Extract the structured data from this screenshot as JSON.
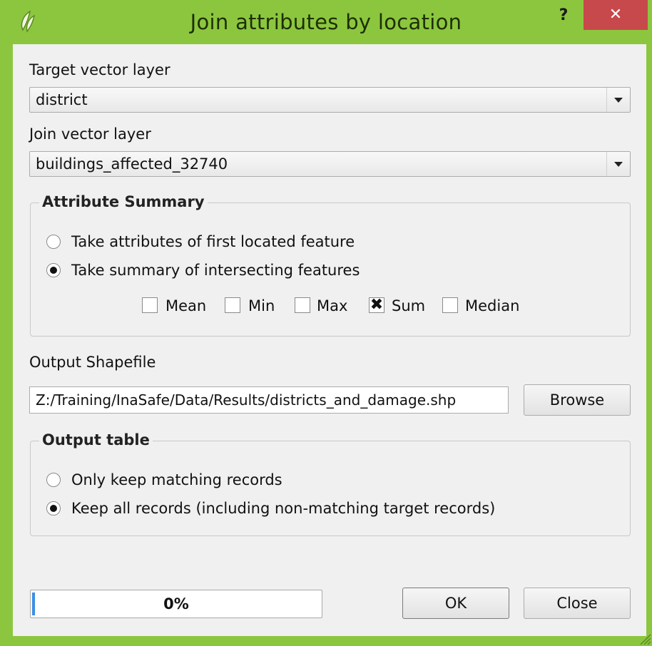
{
  "window": {
    "title": "Join attributes by location",
    "help_label": "?",
    "close_label": "✕"
  },
  "target": {
    "label": "Target vector layer",
    "value": "district"
  },
  "join": {
    "label": "Join vector layer",
    "value": "buildings_affected_32740"
  },
  "attribute_summary": {
    "title": "Attribute Summary",
    "option_first": "Take attributes of first located feature",
    "option_summary": "Take summary of intersecting features",
    "selected": "summary",
    "stats": [
      {
        "label": "Mean",
        "checked": false
      },
      {
        "label": "Min",
        "checked": false
      },
      {
        "label": "Max",
        "checked": false
      },
      {
        "label": "Sum",
        "checked": true
      },
      {
        "label": "Median",
        "checked": false
      }
    ]
  },
  "output": {
    "label": "Output Shapefile",
    "path": "Z:/Training/InaSafe/Data/Results/districts_and_damage.shp",
    "browse_label": "Browse"
  },
  "output_table": {
    "title": "Output table",
    "option_matching": "Only keep matching records",
    "option_all": "Keep all records (including non-matching target records)",
    "selected": "all"
  },
  "progress": {
    "value": 0,
    "text": "0%"
  },
  "buttons": {
    "ok": "OK",
    "close": "Close"
  },
  "colors": {
    "frame": "#8cc63f",
    "close_button": "#c7494b",
    "progress_fill": "#3a8ee6"
  }
}
